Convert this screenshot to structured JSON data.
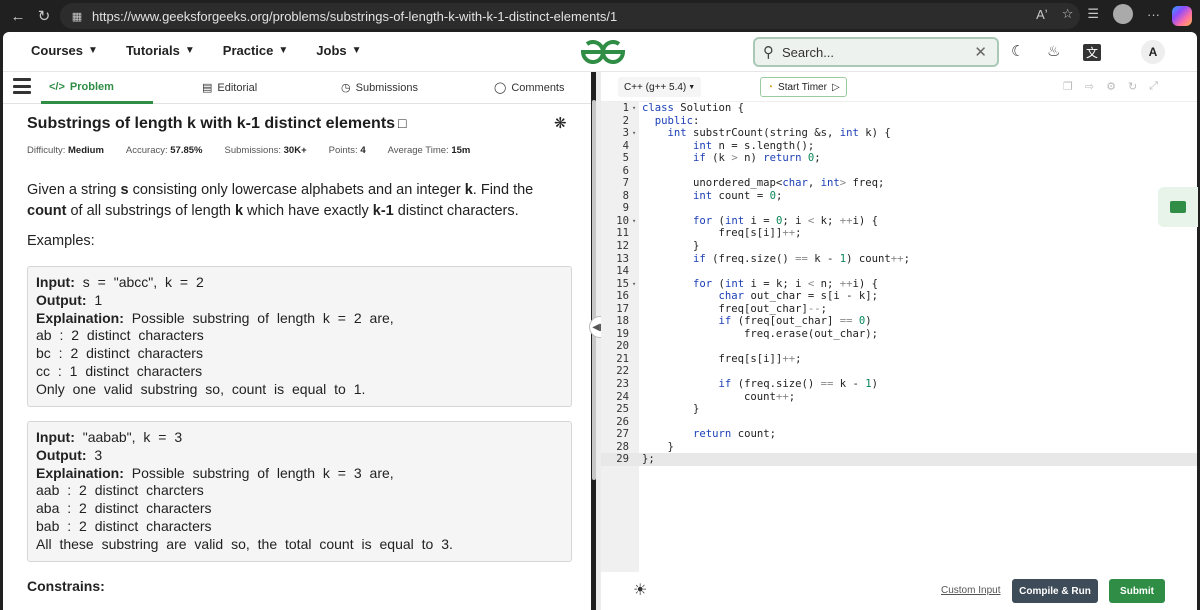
{
  "browser": {
    "url": "https://www.geeksforgeeks.org/problems/substrings-of-length-k-with-k-1-distinct-elements/1",
    "read_aloud": "Aʼ",
    "more": "···"
  },
  "header": {
    "nav": [
      "Courses",
      "Tutorials",
      "Practice",
      "Jobs"
    ],
    "search_placeholder": "Search...",
    "avatar_letter": "A"
  },
  "tabs": {
    "problem": "Problem",
    "editorial": "Editorial",
    "submissions": "Submissions",
    "comments": "Comments"
  },
  "problem": {
    "title": "Substrings of length k with k-1 distinct elements",
    "difficulty_label": "Difficulty:",
    "difficulty": "Medium",
    "accuracy_label": "Accuracy:",
    "accuracy": "57.85%",
    "submissions_label": "Submissions:",
    "submissions": "30K+",
    "points_label": "Points:",
    "points": "4",
    "avg_time_label": "Average Time:",
    "avg_time": "15m",
    "desc_1": "Given a string ",
    "desc_s": "s",
    "desc_2": " consisting only lowercase alphabets and an integer ",
    "desc_k": "k",
    "desc_3": ". Find the ",
    "desc_count": "count",
    "desc_4": " of all substrings of length ",
    "desc_k2": "k",
    "desc_5": " which have exactly ",
    "desc_k1": "k-1",
    "desc_6": " distinct characters.",
    "examples_label": "Examples:",
    "constrains_label": "Constrains:"
  },
  "examples": [
    {
      "input_label": "Input:",
      "input": "s = \"abcc\", k = 2",
      "output_label": "Output:",
      "output": "1",
      "expl_label": "Explaination:",
      "expl": "Possible substring of length k = 2 are,",
      "lines": [
        "ab : 2 distinct characters",
        "bc : 2 distinct characters",
        "cc : 1 distinct characters",
        "Only one valid substring so, count is equal to 1."
      ]
    },
    {
      "input_label": "Input:",
      "input": "\"aabab\", k = 3",
      "output_label": "Output:",
      "output": "3",
      "expl_label": "Explaination:",
      "expl": "Possible substring of length k = 3 are,",
      "lines": [
        "aab : 2 distinct charcters",
        "aba : 2 distinct characters",
        "bab : 2 distinct characters",
        "All these substring are valid so, the total count is equal to 3."
      ]
    }
  ],
  "editor": {
    "language": "C++ (g++ 5.4)",
    "start_timer": "Start Timer",
    "custom_input": "Custom Input",
    "compile_run": "Compile & Run",
    "submit": "Submit",
    "lines": [
      "class Solution {",
      "  public:",
      "    int substrCount(string &s, int k) {",
      "        int n = s.length();",
      "        if (k > n) return 0;",
      "",
      "        unordered_map<char, int> freq;",
      "        int count = 0;",
      "",
      "        for (int i = 0; i < k; ++i) {",
      "            freq[s[i]]++;",
      "        }",
      "        if (freq.size() == k - 1) count++;",
      "",
      "        for (int i = k; i < n; ++i) {",
      "            char out_char = s[i - k];",
      "            freq[out_char]--;",
      "            if (freq[out_char] == 0)",
      "                freq.erase(out_char);",
      "",
      "            freq[s[i]]++;",
      "",
      "            if (freq.size() == k - 1)",
      "                count++;",
      "        }",
      "",
      "        return count;",
      "    }",
      "};"
    ],
    "fold_lines": [
      1,
      3,
      10,
      15
    ],
    "active_line": 29
  }
}
